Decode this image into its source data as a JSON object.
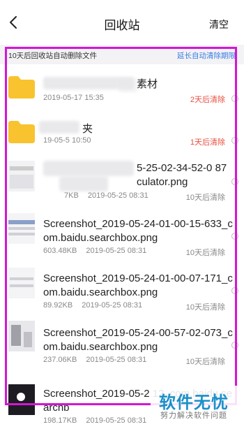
{
  "header": {
    "title": "回收站",
    "clear_label": "清空"
  },
  "notice": {
    "text": "10天后回收站自动删除文件",
    "link": "延长自动清除期限"
  },
  "items": [
    {
      "name": "素材",
      "size": "",
      "date": "2019-05-17  15:35",
      "expire": "2天后清除",
      "expire_color": "#e94c3d",
      "kind": "folder"
    },
    {
      "name": "夹",
      "size": "",
      "date": "19-05-5  10:50",
      "expire": "1天后清除",
      "expire_color": "#e94c3d",
      "kind": "folder"
    },
    {
      "name": "5-25-02-34-52-0 87 culator.png",
      "size": "7KB",
      "date": "2019-05-25  08:31",
      "expire": "10天后清除",
      "expire_color": "#888888",
      "kind": "image"
    },
    {
      "name": "Screenshot_2019-05-24-01-00-15-633_com.baidu.searchbox.png",
      "size": "603.48KB",
      "date": "2019-05-25  08:31",
      "expire": "10天后清除",
      "expire_color": "#888888",
      "kind": "image"
    },
    {
      "name": "Screenshot_2019-05-24-01-00-07-171_com.baidu.searchbox.png",
      "size": "89.92KB",
      "date": "2019-05-25  08:31",
      "expire": "10天后清除",
      "expire_color": "#888888",
      "kind": "image"
    },
    {
      "name": "Screenshot_2019-05-24-00-57-02-073_com.baidu.searchbox.png",
      "size": "237.06KB",
      "date": "2019-05-25  08:31",
      "expire": "10天后清除",
      "expire_color": "#888888",
      "kind": "image"
    },
    {
      "name": "Screenshot_2019-05-2 12_com.baidu.searchb",
      "size": "198.17KB",
      "date": "2019-05-25  08:31",
      "expire": "",
      "expire_color": "#888888",
      "kind": "image"
    }
  ],
  "watermark": {
    "title": "软件无忧",
    "subtitle": "努力解决软件问题"
  },
  "colors": {
    "accent": "#3b7be0",
    "warning": "#e94c3d",
    "folder": "#f9c32f",
    "highlight": "#d515d6"
  }
}
